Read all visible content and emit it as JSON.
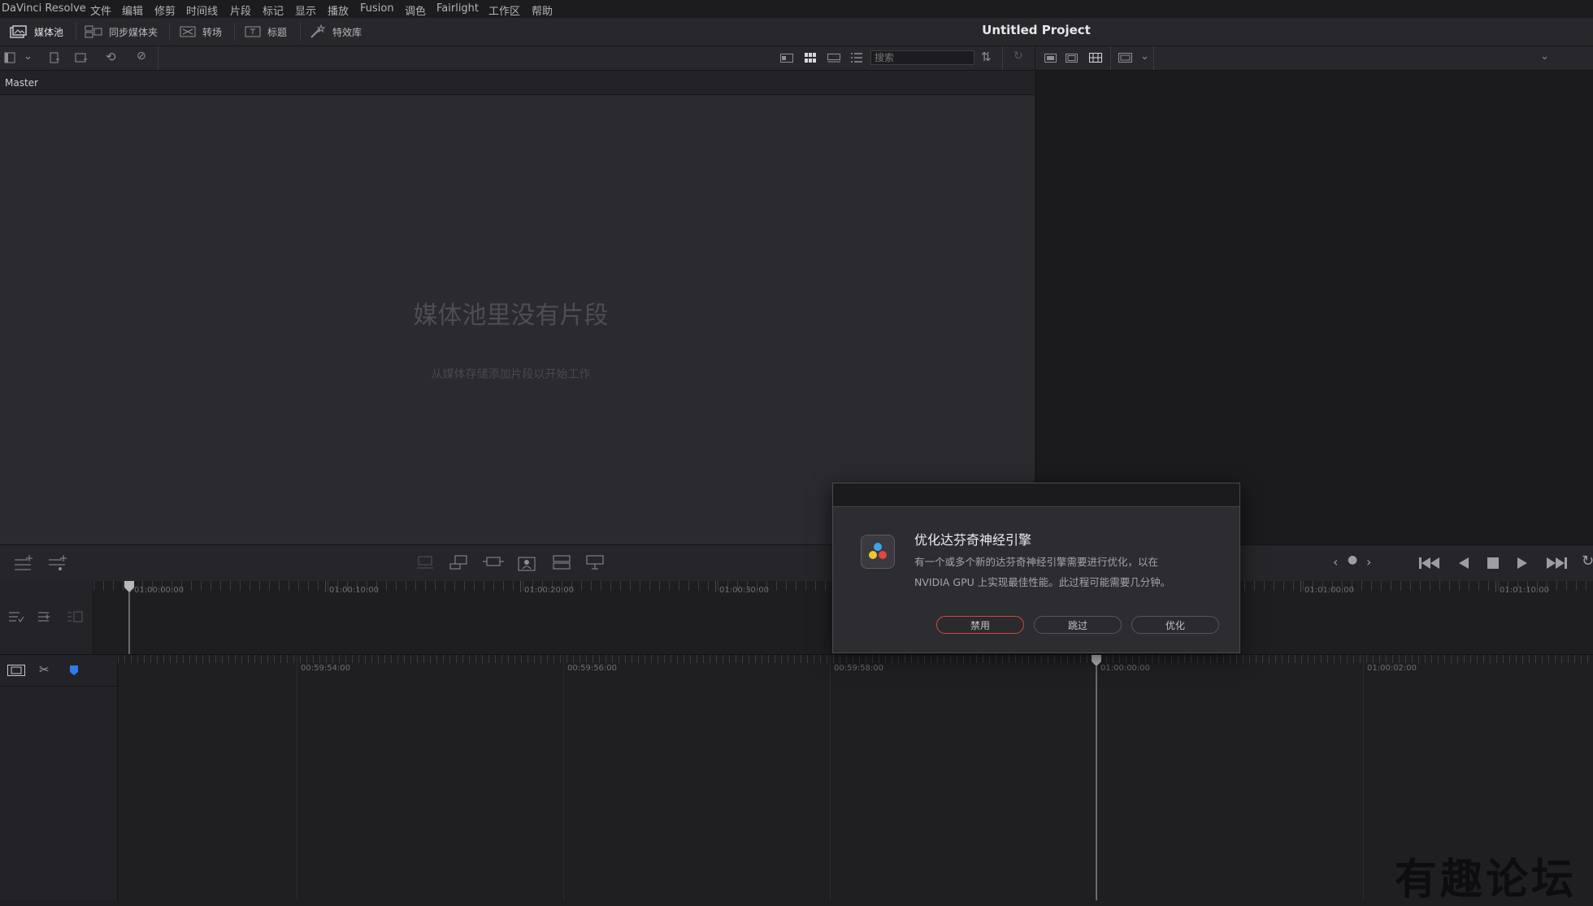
{
  "menubar": {
    "items": [
      "DaVinci Resolve",
      "文件",
      "编辑",
      "修剪",
      "时间线",
      "片段",
      "标记",
      "显示",
      "播放",
      "Fusion",
      "调色",
      "Fairlight",
      "工作区",
      "帮助"
    ]
  },
  "toolbar": {
    "media_pool": "媒体池",
    "sync_bin": "同步媒体夹",
    "transitions": "转场",
    "titles": "标题",
    "effects": "特效库",
    "project_title": "Untitled Project"
  },
  "subbar": {
    "search_placeholder": "搜索"
  },
  "media_pool": {
    "bin_label": "Master",
    "empty_title": "媒体池里没有片段",
    "empty_subtitle": "从媒体存储添加片段以开始工作"
  },
  "timeline_upper": {
    "labels": [
      "01:00:00:00",
      "01:00:10:00",
      "01:00:20:00",
      "01:00:30:00",
      "01:01:00:00",
      "01:01:10:00"
    ]
  },
  "timeline_lower": {
    "labels": [
      "00:59:54:00",
      "00:59:56:00",
      "00:59:58:00",
      "01:00:00:00",
      "01:00:02:00"
    ]
  },
  "dialog": {
    "title": "优化达芬奇神经引擎",
    "message_line1": "有一个或多个新的达芬奇神经引擎需要进行优化，以在",
    "message_line2": "NVIDIA GPU 上实现最佳性能。此过程可能需要几分钟。",
    "btn_disable": "禁用",
    "btn_skip": "跳过",
    "btn_optimize": "优化"
  },
  "colors": {
    "accent_red": "#d44a3a",
    "marker_blue": "#2f7bea"
  },
  "watermark": "有趣论坛"
}
